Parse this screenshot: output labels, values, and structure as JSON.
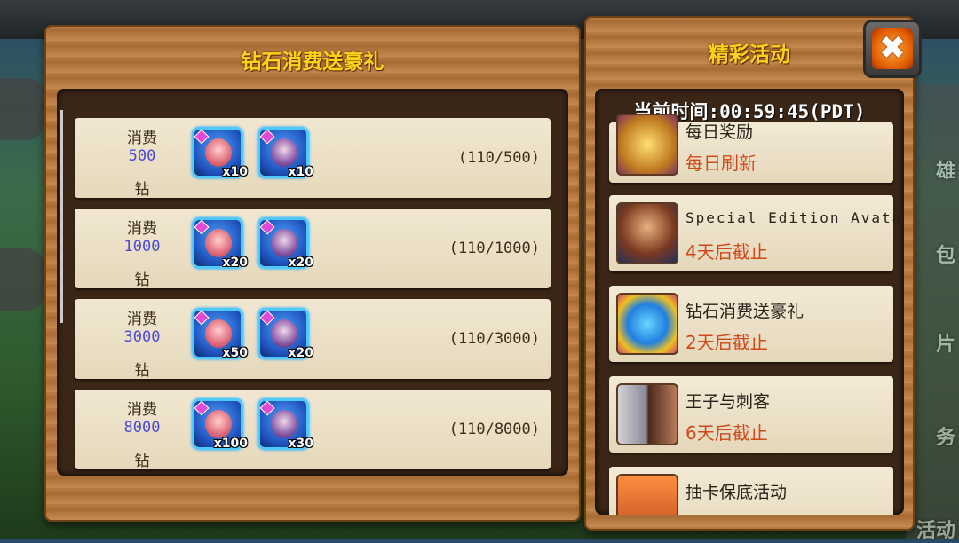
{
  "left_panel": {
    "title": "钻石消费送豪礼",
    "rows": [
      {
        "label_top": "消费",
        "amount": "500",
        "label_bottom": "钻",
        "progress": "(110/500)",
        "items": [
          {
            "kind": "pink",
            "qty": "x10"
          },
          {
            "kind": "purple",
            "qty": "x10"
          }
        ]
      },
      {
        "label_top": "消费",
        "amount": "1000",
        "label_bottom": "钻",
        "progress": "(110/1000)",
        "items": [
          {
            "kind": "pink",
            "qty": "x20"
          },
          {
            "kind": "purple",
            "qty": "x20"
          }
        ]
      },
      {
        "label_top": "消费",
        "amount": "3000",
        "label_bottom": "钻",
        "progress": "(110/3000)",
        "items": [
          {
            "kind": "pink",
            "qty": "x50"
          },
          {
            "kind": "purple",
            "qty": "x20"
          }
        ]
      },
      {
        "label_top": "消费",
        "amount": "8000",
        "label_bottom": "钻",
        "progress": "(110/8000)",
        "items": [
          {
            "kind": "pink",
            "qty": "x100"
          },
          {
            "kind": "purple",
            "qty": "x30"
          }
        ]
      }
    ]
  },
  "right_panel": {
    "title": "精彩活动",
    "current_time": "当前时间:00:59:45(PDT)",
    "events": [
      {
        "title": "每日奖励",
        "subtitle": "每日刷新",
        "icon": "treasure-chest-icon"
      },
      {
        "title": "Special Edition Avatar",
        "subtitle": "4天后截止",
        "icon": "avatar-icon"
      },
      {
        "title": "钻石消费送豪礼",
        "subtitle": "2天后截止",
        "icon": "diamond-refresh-icon"
      },
      {
        "title": "王子与刺客",
        "subtitle": "6天后截止",
        "icon": "prince-assassin-icon"
      },
      {
        "title": "抽卡保底活动",
        "subtitle": "",
        "icon": "card-draw-icon"
      }
    ],
    "close_label": "✖"
  },
  "background": {
    "side_labels": [
      "雄",
      "包",
      "片",
      "务",
      "活动"
    ]
  },
  "colors": {
    "title_gold": "#ffd21a",
    "deadline_orange": "#d0491b",
    "amount_blue": "#4a4ad8"
  }
}
